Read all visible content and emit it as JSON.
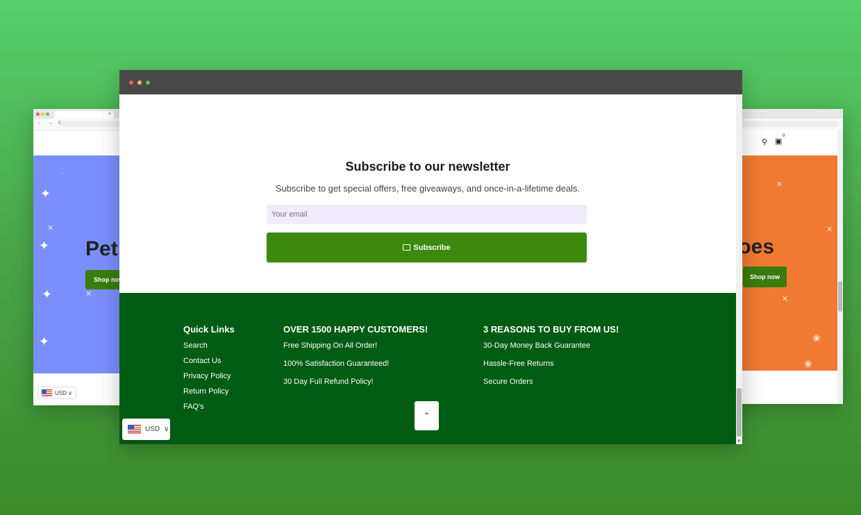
{
  "back_left": {
    "tab_close": "×",
    "nav": "← → C",
    "hero_heading": "Pet",
    "shop_now": "Shop now",
    "currency": "USD ∨"
  },
  "back_right": {
    "cart_count": "0",
    "hero_heading": "hoes",
    "shop_now": "Shop now"
  },
  "newsletter": {
    "title": "Subscribe to our newsletter",
    "subtitle": "Subscribe to get special offers, free giveaways, and once-in-a-lifetime deals.",
    "email_placeholder": "Your email",
    "subscribe_label": "Subscribe"
  },
  "footer": {
    "quick_links": {
      "heading": "Quick Links",
      "items": [
        "Search",
        "Contact Us",
        "Privacy Policy",
        "Return Policy",
        "FAQ's"
      ]
    },
    "customers": {
      "heading": "OVER 1500 HAPPY CUSTOMERS!",
      "items": [
        "Free Shipping On All Order!",
        "100% Satisfaction Guaranteed!",
        "30 Day Full Refund Policy!"
      ]
    },
    "reasons": {
      "heading": "3 REASONS TO BUY FROM US!",
      "items": [
        "30-Day Money Back Guarantee",
        "Hassle-Free Returns",
        "Secure Orders"
      ]
    },
    "back_to_top": "⌃"
  },
  "currency_selector": {
    "value": "USD",
    "chevron": "∨"
  },
  "colors": {
    "brand_green": "#3c890e",
    "footer_green": "#005c13",
    "left_hero": "#7b8ffc",
    "right_hero": "#f07a32"
  }
}
